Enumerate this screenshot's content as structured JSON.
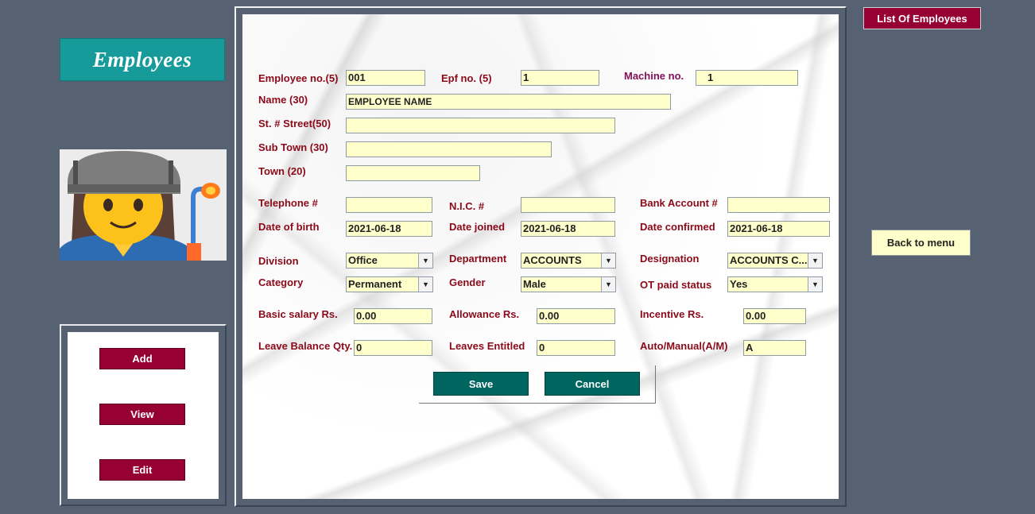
{
  "header": {
    "title": "Employees"
  },
  "sidebar": {
    "add": "Add",
    "view": "View",
    "edit": "Edit"
  },
  "top_right": {
    "list_employees": "List Of Employees",
    "back_to_menu": "Back to menu"
  },
  "form": {
    "employee_no": {
      "label": "Employee no.(5)",
      "value": "001"
    },
    "epf_no": {
      "label": "Epf no. (5)",
      "value": "1"
    },
    "machine_no": {
      "label": "Machine no.",
      "value": "1"
    },
    "name": {
      "label": "Name (30)",
      "value": "EMPLOYEE NAME"
    },
    "street": {
      "label": "St. # Street(50)",
      "value": ""
    },
    "sub_town": {
      "label": "Sub Town (30)",
      "value": ""
    },
    "town": {
      "label": "Town  (20)",
      "value": ""
    },
    "telephone": {
      "label": "Telephone #",
      "value": ""
    },
    "nic": {
      "label": "N.I.C. #",
      "value": ""
    },
    "bank_account": {
      "label": "Bank Account #",
      "value": ""
    },
    "date_of_birth": {
      "label": "Date of birth",
      "value": "2021-06-18"
    },
    "date_joined": {
      "label": "Date joined",
      "value": "2021-06-18"
    },
    "date_confirmed": {
      "label": "Date confirmed",
      "value": "2021-06-18"
    },
    "division": {
      "label": "Division",
      "value": "Office"
    },
    "department": {
      "label": "Department",
      "value": "ACCOUNTS"
    },
    "designation": {
      "label": "Designation",
      "value": "ACCOUNTS C..."
    },
    "category": {
      "label": "Category",
      "value": "Permanent"
    },
    "gender": {
      "label": "Gender",
      "value": "Male"
    },
    "ot_paid_status": {
      "label": "OT paid status",
      "value": "Yes"
    },
    "basic_salary": {
      "label": "Basic salary Rs.",
      "value": "0.00"
    },
    "allowance": {
      "label": "Allowance Rs.",
      "value": "0.00"
    },
    "incentive": {
      "label": "Incentive Rs.",
      "value": "0.00"
    },
    "leave_balance": {
      "label": "Leave Balance Qty.",
      "value": "0"
    },
    "leaves_entitled": {
      "label": "Leaves Entitled",
      "value": "0"
    },
    "auto_manual": {
      "label": "Auto/Manual(A/M)",
      "value": "A"
    }
  },
  "actions": {
    "save": "Save",
    "cancel": "Cancel"
  },
  "icons": {
    "dropdown": "chevron-down-icon",
    "avatar": "woman-worker-icon"
  },
  "colors": {
    "background": "#566272",
    "banner": "#169a9a",
    "maroon_button": "#960032",
    "teal_button": "#00645f",
    "field": "#ffffcc",
    "label": "#8b0a1a"
  }
}
